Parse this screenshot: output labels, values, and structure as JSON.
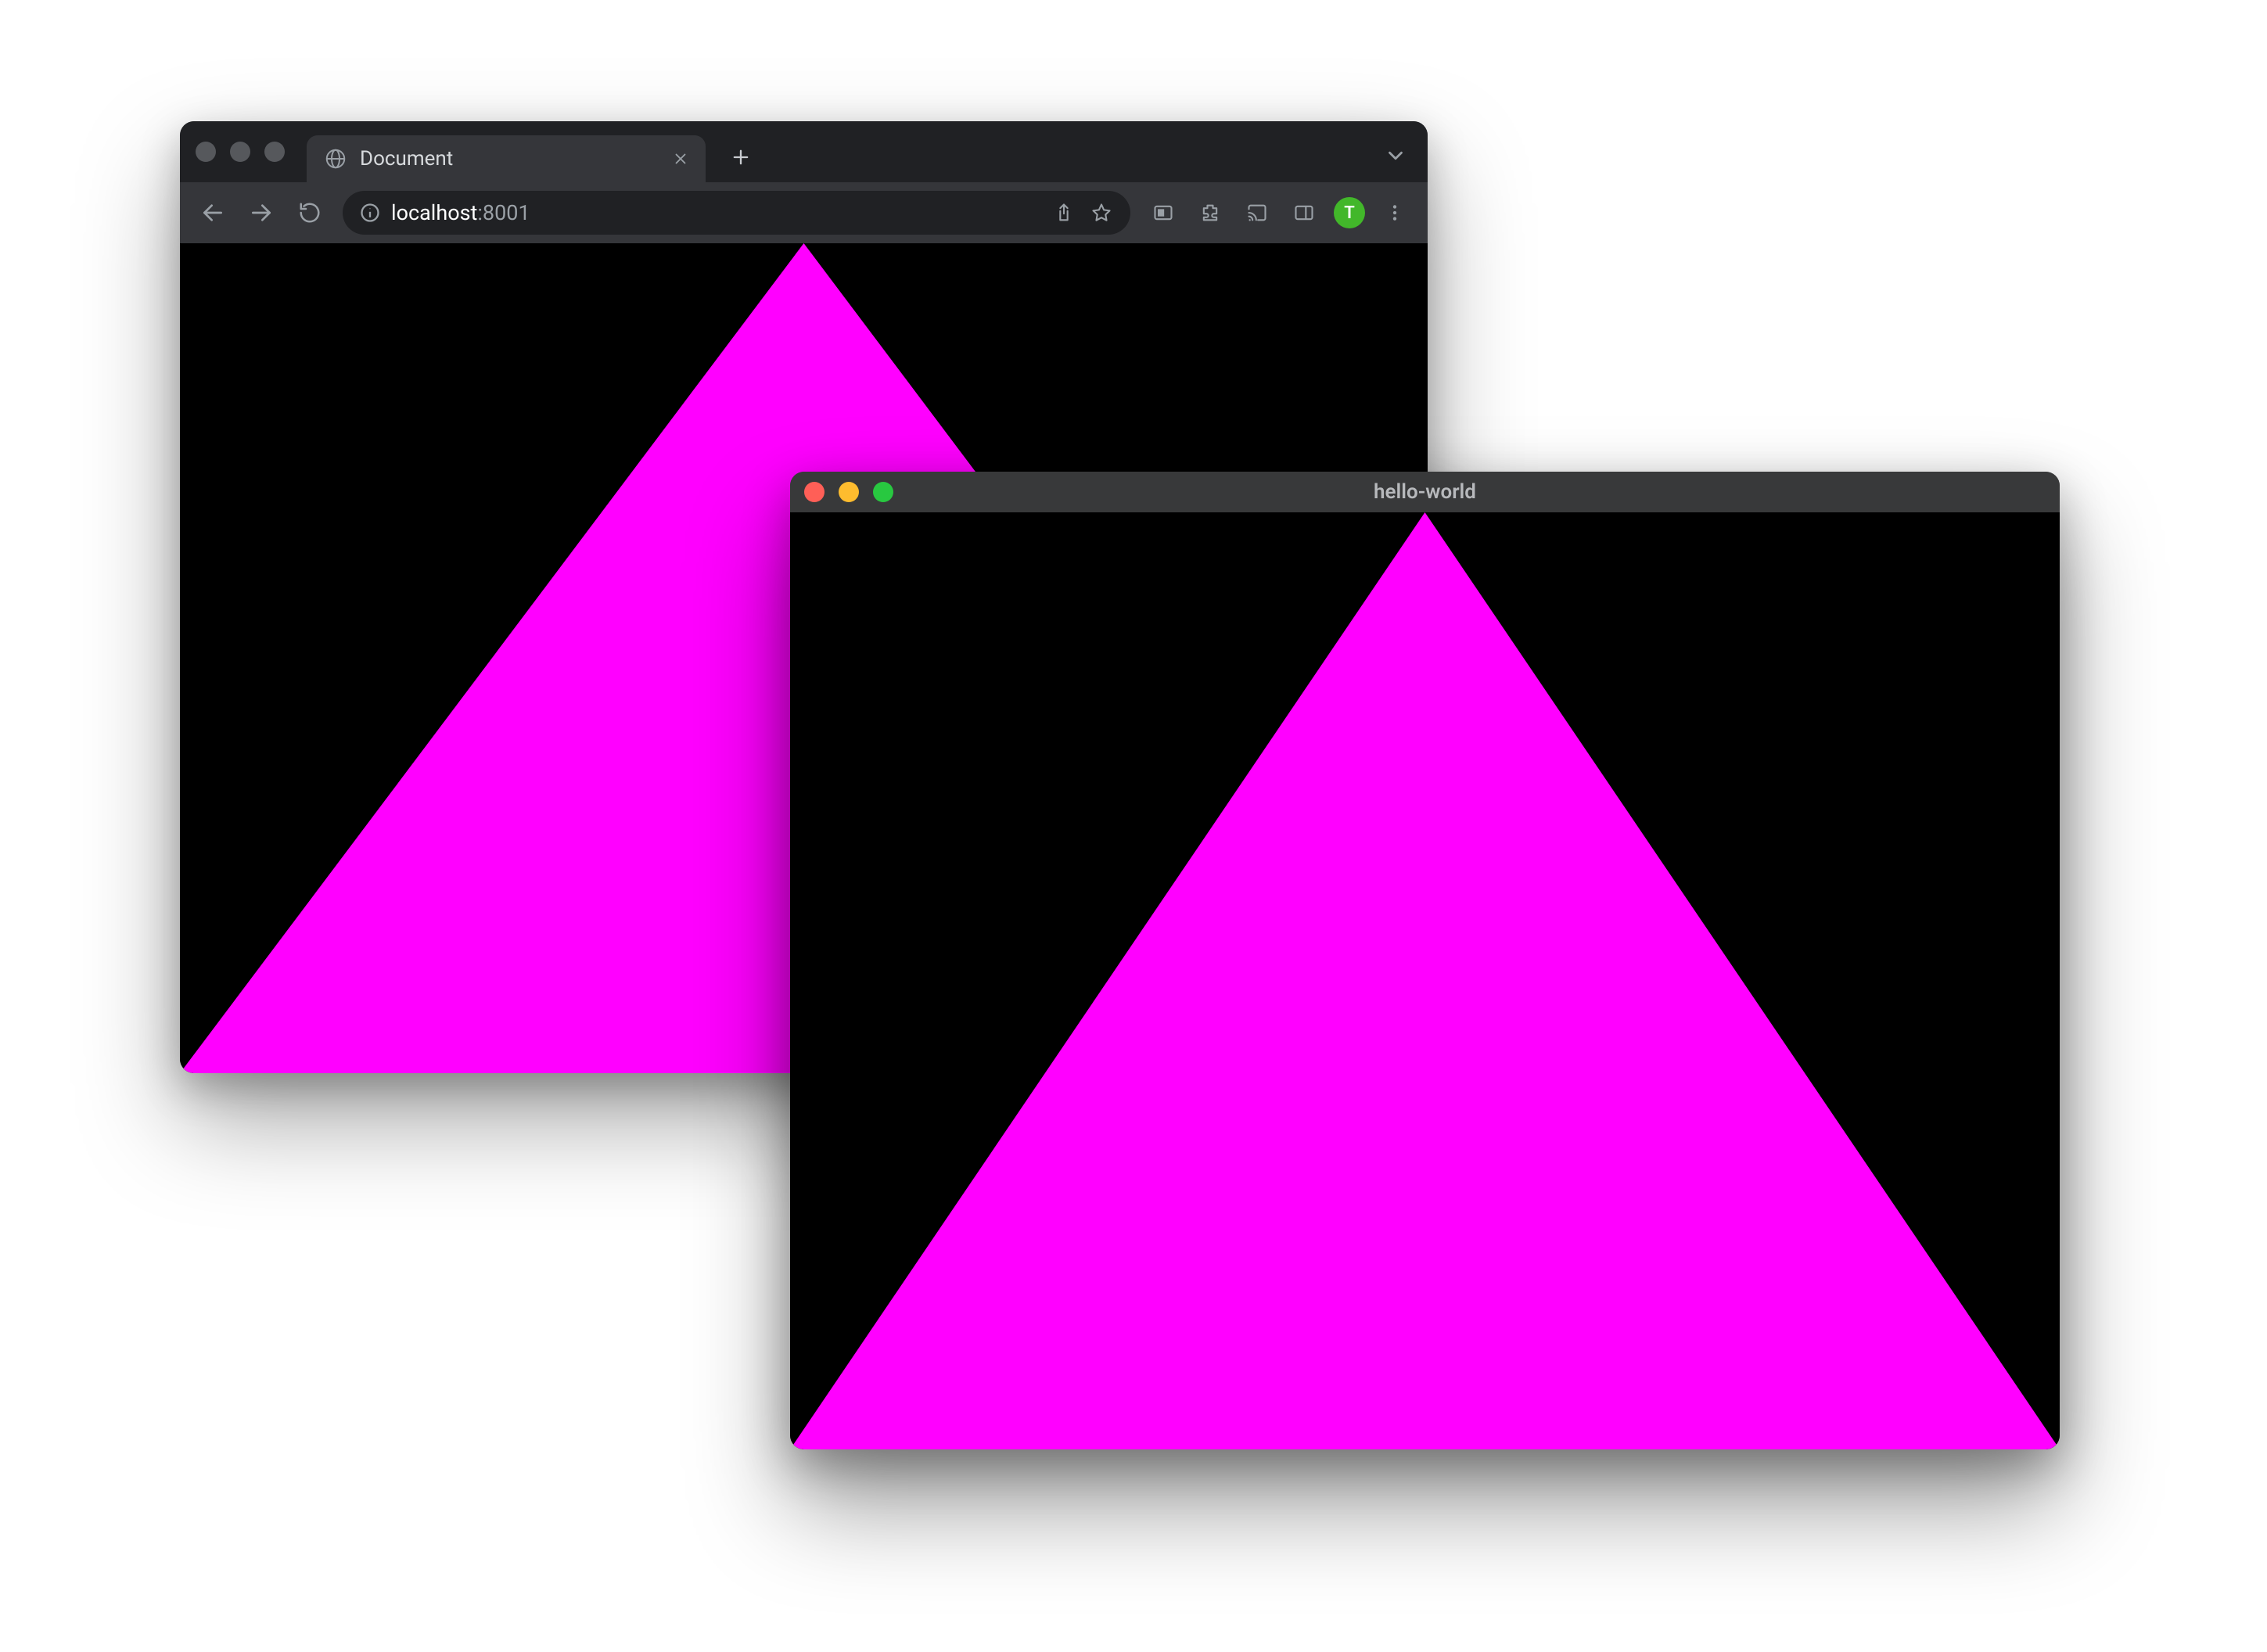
{
  "browser": {
    "tab": {
      "title": "Document"
    },
    "url": {
      "host": "localhost",
      "rest": ":8001"
    },
    "profile": {
      "initial": "T"
    }
  },
  "app": {
    "title": "hello-world"
  },
  "triangle_color": "#ff00ff",
  "content_bg": "#000000"
}
